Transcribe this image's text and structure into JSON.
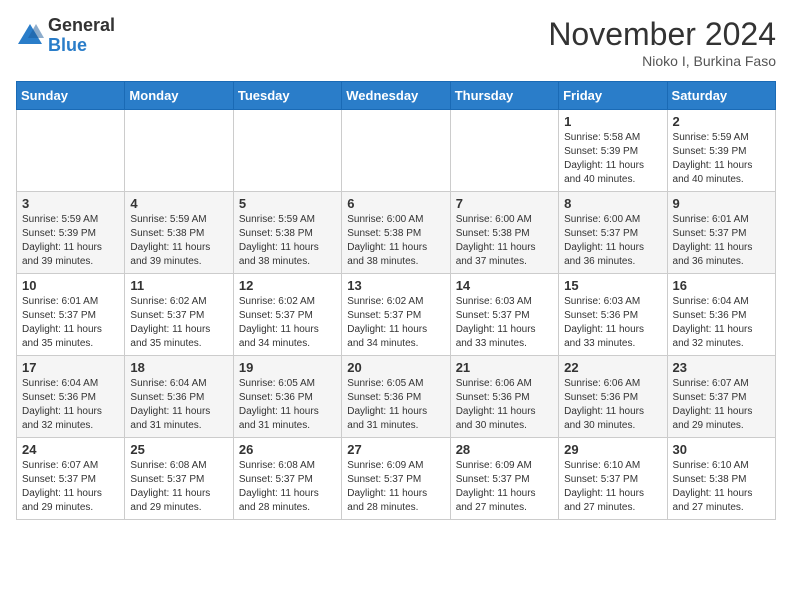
{
  "header": {
    "logo_general": "General",
    "logo_blue": "Blue",
    "month_title": "November 2024",
    "location": "Nioko I, Burkina Faso"
  },
  "weekdays": [
    "Sunday",
    "Monday",
    "Tuesday",
    "Wednesday",
    "Thursday",
    "Friday",
    "Saturday"
  ],
  "weeks": [
    [
      {
        "day": "",
        "info": ""
      },
      {
        "day": "",
        "info": ""
      },
      {
        "day": "",
        "info": ""
      },
      {
        "day": "",
        "info": ""
      },
      {
        "day": "",
        "info": ""
      },
      {
        "day": "1",
        "info": "Sunrise: 5:58 AM\nSunset: 5:39 PM\nDaylight: 11 hours and 40 minutes."
      },
      {
        "day": "2",
        "info": "Sunrise: 5:59 AM\nSunset: 5:39 PM\nDaylight: 11 hours and 40 minutes."
      }
    ],
    [
      {
        "day": "3",
        "info": "Sunrise: 5:59 AM\nSunset: 5:39 PM\nDaylight: 11 hours and 39 minutes."
      },
      {
        "day": "4",
        "info": "Sunrise: 5:59 AM\nSunset: 5:38 PM\nDaylight: 11 hours and 39 minutes."
      },
      {
        "day": "5",
        "info": "Sunrise: 5:59 AM\nSunset: 5:38 PM\nDaylight: 11 hours and 38 minutes."
      },
      {
        "day": "6",
        "info": "Sunrise: 6:00 AM\nSunset: 5:38 PM\nDaylight: 11 hours and 38 minutes."
      },
      {
        "day": "7",
        "info": "Sunrise: 6:00 AM\nSunset: 5:38 PM\nDaylight: 11 hours and 37 minutes."
      },
      {
        "day": "8",
        "info": "Sunrise: 6:00 AM\nSunset: 5:37 PM\nDaylight: 11 hours and 36 minutes."
      },
      {
        "day": "9",
        "info": "Sunrise: 6:01 AM\nSunset: 5:37 PM\nDaylight: 11 hours and 36 minutes."
      }
    ],
    [
      {
        "day": "10",
        "info": "Sunrise: 6:01 AM\nSunset: 5:37 PM\nDaylight: 11 hours and 35 minutes."
      },
      {
        "day": "11",
        "info": "Sunrise: 6:02 AM\nSunset: 5:37 PM\nDaylight: 11 hours and 35 minutes."
      },
      {
        "day": "12",
        "info": "Sunrise: 6:02 AM\nSunset: 5:37 PM\nDaylight: 11 hours and 34 minutes."
      },
      {
        "day": "13",
        "info": "Sunrise: 6:02 AM\nSunset: 5:37 PM\nDaylight: 11 hours and 34 minutes."
      },
      {
        "day": "14",
        "info": "Sunrise: 6:03 AM\nSunset: 5:37 PM\nDaylight: 11 hours and 33 minutes."
      },
      {
        "day": "15",
        "info": "Sunrise: 6:03 AM\nSunset: 5:36 PM\nDaylight: 11 hours and 33 minutes."
      },
      {
        "day": "16",
        "info": "Sunrise: 6:04 AM\nSunset: 5:36 PM\nDaylight: 11 hours and 32 minutes."
      }
    ],
    [
      {
        "day": "17",
        "info": "Sunrise: 6:04 AM\nSunset: 5:36 PM\nDaylight: 11 hours and 32 minutes."
      },
      {
        "day": "18",
        "info": "Sunrise: 6:04 AM\nSunset: 5:36 PM\nDaylight: 11 hours and 31 minutes."
      },
      {
        "day": "19",
        "info": "Sunrise: 6:05 AM\nSunset: 5:36 PM\nDaylight: 11 hours and 31 minutes."
      },
      {
        "day": "20",
        "info": "Sunrise: 6:05 AM\nSunset: 5:36 PM\nDaylight: 11 hours and 31 minutes."
      },
      {
        "day": "21",
        "info": "Sunrise: 6:06 AM\nSunset: 5:36 PM\nDaylight: 11 hours and 30 minutes."
      },
      {
        "day": "22",
        "info": "Sunrise: 6:06 AM\nSunset: 5:36 PM\nDaylight: 11 hours and 30 minutes."
      },
      {
        "day": "23",
        "info": "Sunrise: 6:07 AM\nSunset: 5:37 PM\nDaylight: 11 hours and 29 minutes."
      }
    ],
    [
      {
        "day": "24",
        "info": "Sunrise: 6:07 AM\nSunset: 5:37 PM\nDaylight: 11 hours and 29 minutes."
      },
      {
        "day": "25",
        "info": "Sunrise: 6:08 AM\nSunset: 5:37 PM\nDaylight: 11 hours and 29 minutes."
      },
      {
        "day": "26",
        "info": "Sunrise: 6:08 AM\nSunset: 5:37 PM\nDaylight: 11 hours and 28 minutes."
      },
      {
        "day": "27",
        "info": "Sunrise: 6:09 AM\nSunset: 5:37 PM\nDaylight: 11 hours and 28 minutes."
      },
      {
        "day": "28",
        "info": "Sunrise: 6:09 AM\nSunset: 5:37 PM\nDaylight: 11 hours and 27 minutes."
      },
      {
        "day": "29",
        "info": "Sunrise: 6:10 AM\nSunset: 5:37 PM\nDaylight: 11 hours and 27 minutes."
      },
      {
        "day": "30",
        "info": "Sunrise: 6:10 AM\nSunset: 5:38 PM\nDaylight: 11 hours and 27 minutes."
      }
    ]
  ]
}
